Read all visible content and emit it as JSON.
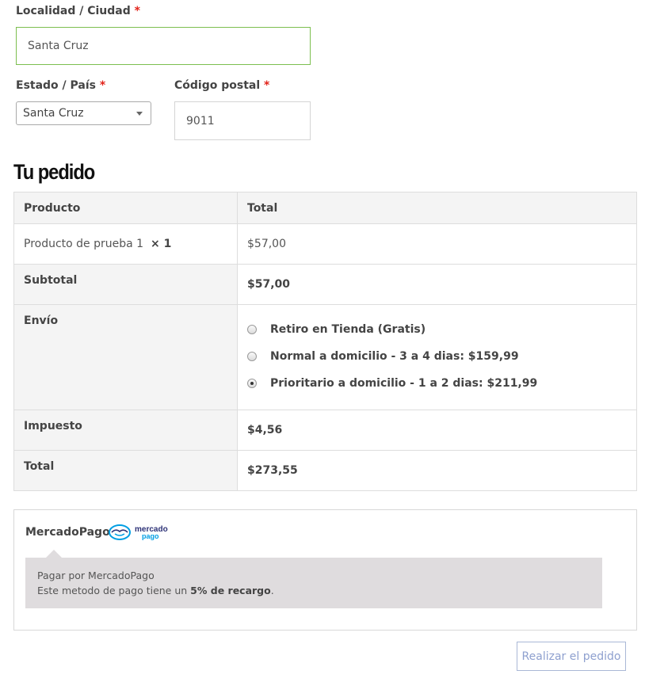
{
  "city": {
    "label": "Localidad / Ciudad",
    "required_mark": "*",
    "value": "Santa Cruz"
  },
  "state": {
    "label": "Estado / País",
    "required_mark": "*",
    "selected": "Santa Cruz"
  },
  "postcode": {
    "label": "Código postal",
    "required_mark": "*",
    "value": "9011"
  },
  "order": {
    "heading": "Tu pedido",
    "col_product": "Producto",
    "col_total": "Total",
    "item": {
      "name": "Producto de prueba 1",
      "qty": "× 1",
      "total": "$57,00"
    },
    "subtotal": {
      "label": "Subtotal",
      "value": "$57,00"
    },
    "shipping": {
      "label": "Envío",
      "options": [
        {
          "label": "Retiro en Tienda (Gratis)",
          "checked": false
        },
        {
          "label": "Normal a domicilio - 3 a 4 dias: $159,99",
          "checked": false
        },
        {
          "label": "Prioritario a domicilio - 1 a 2 dias: $211,99",
          "checked": true
        }
      ]
    },
    "tax": {
      "label": "Impuesto",
      "value": "$4,56"
    },
    "total": {
      "label": "Total",
      "value": "$273,55"
    }
  },
  "payment": {
    "method": "MercadoPago",
    "logo_text": [
      "mercado",
      "pago"
    ],
    "desc_line1": "Pagar por MercadoPago",
    "desc_pre": "Este metodo de pago tiene un ",
    "desc_bold": "5% de recargo",
    "desc_post": "."
  },
  "place_order": "Realizar el pedido",
  "colors": {
    "required": "#e2231a",
    "focus_border": "#7cbf4f",
    "mp_blue": "#009ee3",
    "mp_navy": "#2d3277"
  }
}
